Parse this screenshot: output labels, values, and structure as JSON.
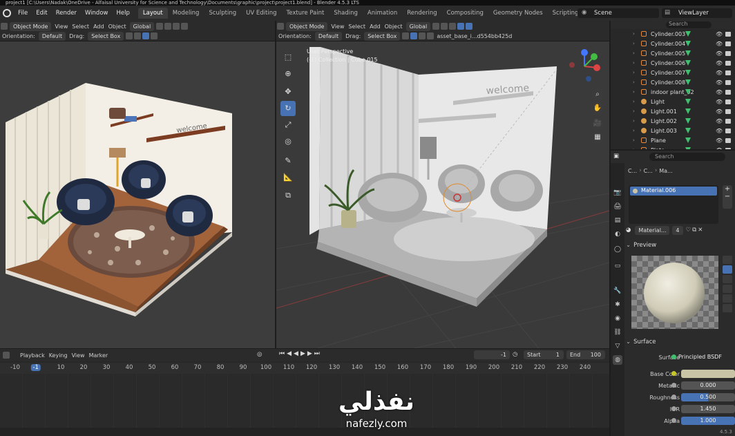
{
  "window": {
    "title": "project1 [C:\\Users\\Nadak\\OneDrive - Alfaisal University for Science and Technology\\Documents\\graphic\\project\\project1.blend] - Blender 4.5.3 LTS"
  },
  "menu": [
    "File",
    "Edit",
    "Render",
    "Window",
    "Help"
  ],
  "workspaces": [
    "Layout",
    "Modeling",
    "Sculpting",
    "UV Editing",
    "Texture Paint",
    "Shading",
    "Animation",
    "Rendering",
    "Compositing",
    "Geometry Nodes",
    "Scripting",
    "+"
  ],
  "active_workspace": "Layout",
  "scene": {
    "name": "Scene",
    "view_layer": "ViewLayer"
  },
  "left_viewport": {
    "mode": "Object Mode",
    "menus": [
      "View",
      "Select",
      "Add",
      "Object"
    ],
    "transform": "Global",
    "orientation_label": "Orientation:",
    "orientation_value": "Default",
    "drag_label": "Drag:",
    "drag_value": "Select Box"
  },
  "right_viewport": {
    "mode": "Object Mode",
    "menus": [
      "View",
      "Select",
      "Add",
      "Object"
    ],
    "transform": "Global",
    "orientation_label": "Orientation:",
    "orientation_value": "Default",
    "drag_label": "Drag:",
    "drag_value": "Select Box",
    "asset_name": "asset_base_i...d554bb425d",
    "overlay_line1": "User Perspective",
    "overlay_line2": "(-1) Collection | Cube.015",
    "scene_text": "welcome"
  },
  "left_scene_text": "welcome",
  "outliner": {
    "search_placeholder": "Search",
    "items": [
      {
        "name": "Cylinder.003",
        "type": "mesh"
      },
      {
        "name": "Cylinder.004",
        "type": "mesh"
      },
      {
        "name": "Cylinder.005",
        "type": "mesh"
      },
      {
        "name": "Cylinder.006",
        "type": "mesh"
      },
      {
        "name": "Cylinder.007",
        "type": "mesh"
      },
      {
        "name": "Cylinder.008",
        "type": "mesh"
      },
      {
        "name": "indoor plant_02",
        "type": "mesh"
      },
      {
        "name": "Light",
        "type": "light"
      },
      {
        "name": "Light.001",
        "type": "light"
      },
      {
        "name": "Light.002",
        "type": "light"
      },
      {
        "name": "Light.003",
        "type": "light"
      },
      {
        "name": "Plane",
        "type": "mesh"
      },
      {
        "name": "Plate",
        "type": "mesh"
      }
    ]
  },
  "properties": {
    "search_placeholder": "Search",
    "breadcrumb": [
      "C...",
      "C...",
      "Ma..."
    ],
    "material_slot": "Material.006",
    "material_name": "Material...",
    "material_users": "4",
    "preview_label": "Preview",
    "surface_section": "Surface",
    "surface_label": "Surface",
    "surface_value": "Principled BSDF",
    "fields": [
      {
        "label": "Base Color",
        "value": "",
        "fill": 0
      },
      {
        "label": "Metallic",
        "value": "0.000",
        "fill": 0
      },
      {
        "label": "Roughness",
        "value": "0.500",
        "fill": 0.5
      },
      {
        "label": "IOR",
        "value": "1.450",
        "fill": 0
      },
      {
        "label": "Alpha",
        "value": "1.000",
        "fill": 1
      }
    ],
    "base_color_hex": "#c9c4a5"
  },
  "timeline": {
    "menus": [
      "Playback",
      "Keying",
      "View",
      "Marker"
    ],
    "current_frame": "-1",
    "start_label": "Start",
    "start_value": "1",
    "end_label": "End",
    "end_value": "100",
    "ruler": [
      "-10",
      "-1",
      "10",
      "20",
      "30",
      "40",
      "50",
      "60",
      "70",
      "80",
      "90",
      "100",
      "110",
      "120",
      "130",
      "140",
      "150",
      "160",
      "170",
      "180",
      "190",
      "200",
      "210",
      "220",
      "230",
      "240"
    ]
  },
  "version": "4.5.3",
  "watermark": {
    "arabic": "نفذلي",
    "latin": "nafezly.com"
  },
  "colors": {
    "accent": "#4772b3",
    "mesh": "#e38a3c",
    "filter": "#3fbf6f"
  }
}
